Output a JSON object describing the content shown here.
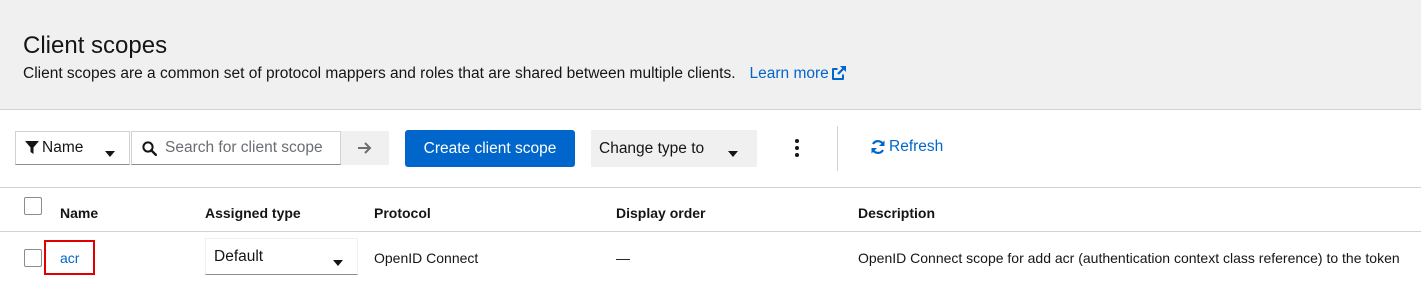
{
  "header": {
    "title": "Client scopes",
    "description": "Client scopes are a common set of protocol mappers and roles that are shared between multiple clients.",
    "learn_more": "Learn more",
    "learn_more_icon": "external-link-icon"
  },
  "toolbar": {
    "filter_label": "Name",
    "filter_icon": "filter-icon",
    "search_placeholder": "Search for client scope",
    "search_value": "",
    "search_icon": "search-icon",
    "submit_icon": "arrow-right-icon",
    "create_label": "Create client scope",
    "change_type_label": "Change type to",
    "kebab_icon": "kebab-icon",
    "refresh_label": "Refresh",
    "refresh_icon": "sync-icon"
  },
  "table": {
    "columns": [
      "Name",
      "Assigned type",
      "Protocol",
      "Display order",
      "Description"
    ],
    "rows": [
      {
        "name": "acr",
        "assigned_type": "Default",
        "protocol": "OpenID Connect",
        "display_order": "—",
        "description": "OpenID Connect scope for add acr (authentication context class reference) to the token"
      }
    ]
  },
  "colors": {
    "accent": "#0066cc",
    "highlight": "#e00000",
    "header_bg": "#f0f0f0"
  }
}
